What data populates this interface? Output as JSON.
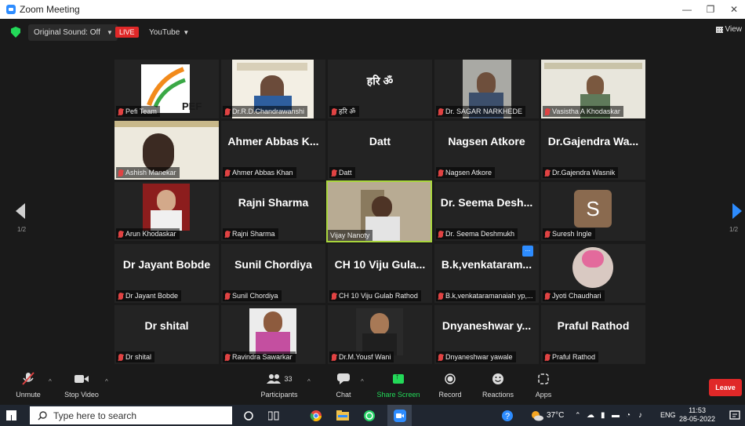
{
  "window": {
    "title": "Zoom Meeting"
  },
  "topbar": {
    "original_sound": "Original Sound: Off",
    "live": "LIVE",
    "youtube": "YouTube",
    "view": "View"
  },
  "gallery": {
    "page_left": "1/2",
    "page_right": "1/2",
    "tiles": [
      {
        "name": "Pefi Team",
        "big": ""
      },
      {
        "name": "Dr.R.D.Chandrawanshi",
        "big": ""
      },
      {
        "name": "हरि ॐ",
        "big": "हरि ॐ"
      },
      {
        "name": "Dr. SAGAR NARKHEDE",
        "big": ""
      },
      {
        "name": "Vasistha A Khodaskar",
        "big": ""
      },
      {
        "name": "Ashish Manekar",
        "big": ""
      },
      {
        "name": "Ahmer Abbas Khan",
        "big": "Ahmer Abbas K..."
      },
      {
        "name": "Datt",
        "big": "Datt"
      },
      {
        "name": "Nagsen Atkore",
        "big": "Nagsen Atkore"
      },
      {
        "name": "Dr.Gajendra Wasnik",
        "big": "Dr.Gajendra Wa..."
      },
      {
        "name": "Arun Khodaskar",
        "big": ""
      },
      {
        "name": "Rajni Sharma",
        "big": "Rajni Sharma"
      },
      {
        "name": "Vijay Nanoty",
        "big": ""
      },
      {
        "name": "Dr. Seema Deshmukh",
        "big": "Dr. Seema Desh..."
      },
      {
        "name": "Suresh Ingle",
        "big": ""
      },
      {
        "name": "Dr Jayant Bobde",
        "big": "Dr Jayant Bobde"
      },
      {
        "name": "Sunil Chordiya",
        "big": "Sunil Chordiya"
      },
      {
        "name": "CH 10 Viju Gulab Rathod",
        "big": "CH 10 Viju Gula..."
      },
      {
        "name": "B.k,venkataramanaiah yp,...",
        "big": "B.k,venkataram..."
      },
      {
        "name": "Jyoti Chaudhari",
        "big": ""
      },
      {
        "name": "Dr shital",
        "big": "Dr shital"
      },
      {
        "name": "Ravindra Sawarkar",
        "big": ""
      },
      {
        "name": "Dr.M.Yousf Wani",
        "big": ""
      },
      {
        "name": "Dnyaneshwar yawale",
        "big": "Dnyaneshwar y..."
      },
      {
        "name": "Praful Rathod",
        "big": "Praful Rathod"
      }
    ],
    "pef_logo_text": "PEF",
    "avatar_letter": "S",
    "more_dots": "..."
  },
  "toolbar": {
    "unmute": "Unmute",
    "stop_video": "Stop Video",
    "participants": "Participants",
    "participants_count": "33",
    "chat": "Chat",
    "share_screen": "Share Screen",
    "record": "Record",
    "reactions": "Reactions",
    "apps": "Apps",
    "leave": "Leave"
  },
  "taskbar": {
    "search_placeholder": "Type here to search",
    "temperature": "37°C",
    "language": "ENG",
    "time": "11:53",
    "date": "28-05-2022"
  },
  "colors": {
    "zoom_blue": "#2d8cff",
    "live_red": "#e02828",
    "share_green": "#23d959",
    "active_border": "#a9d63d"
  }
}
